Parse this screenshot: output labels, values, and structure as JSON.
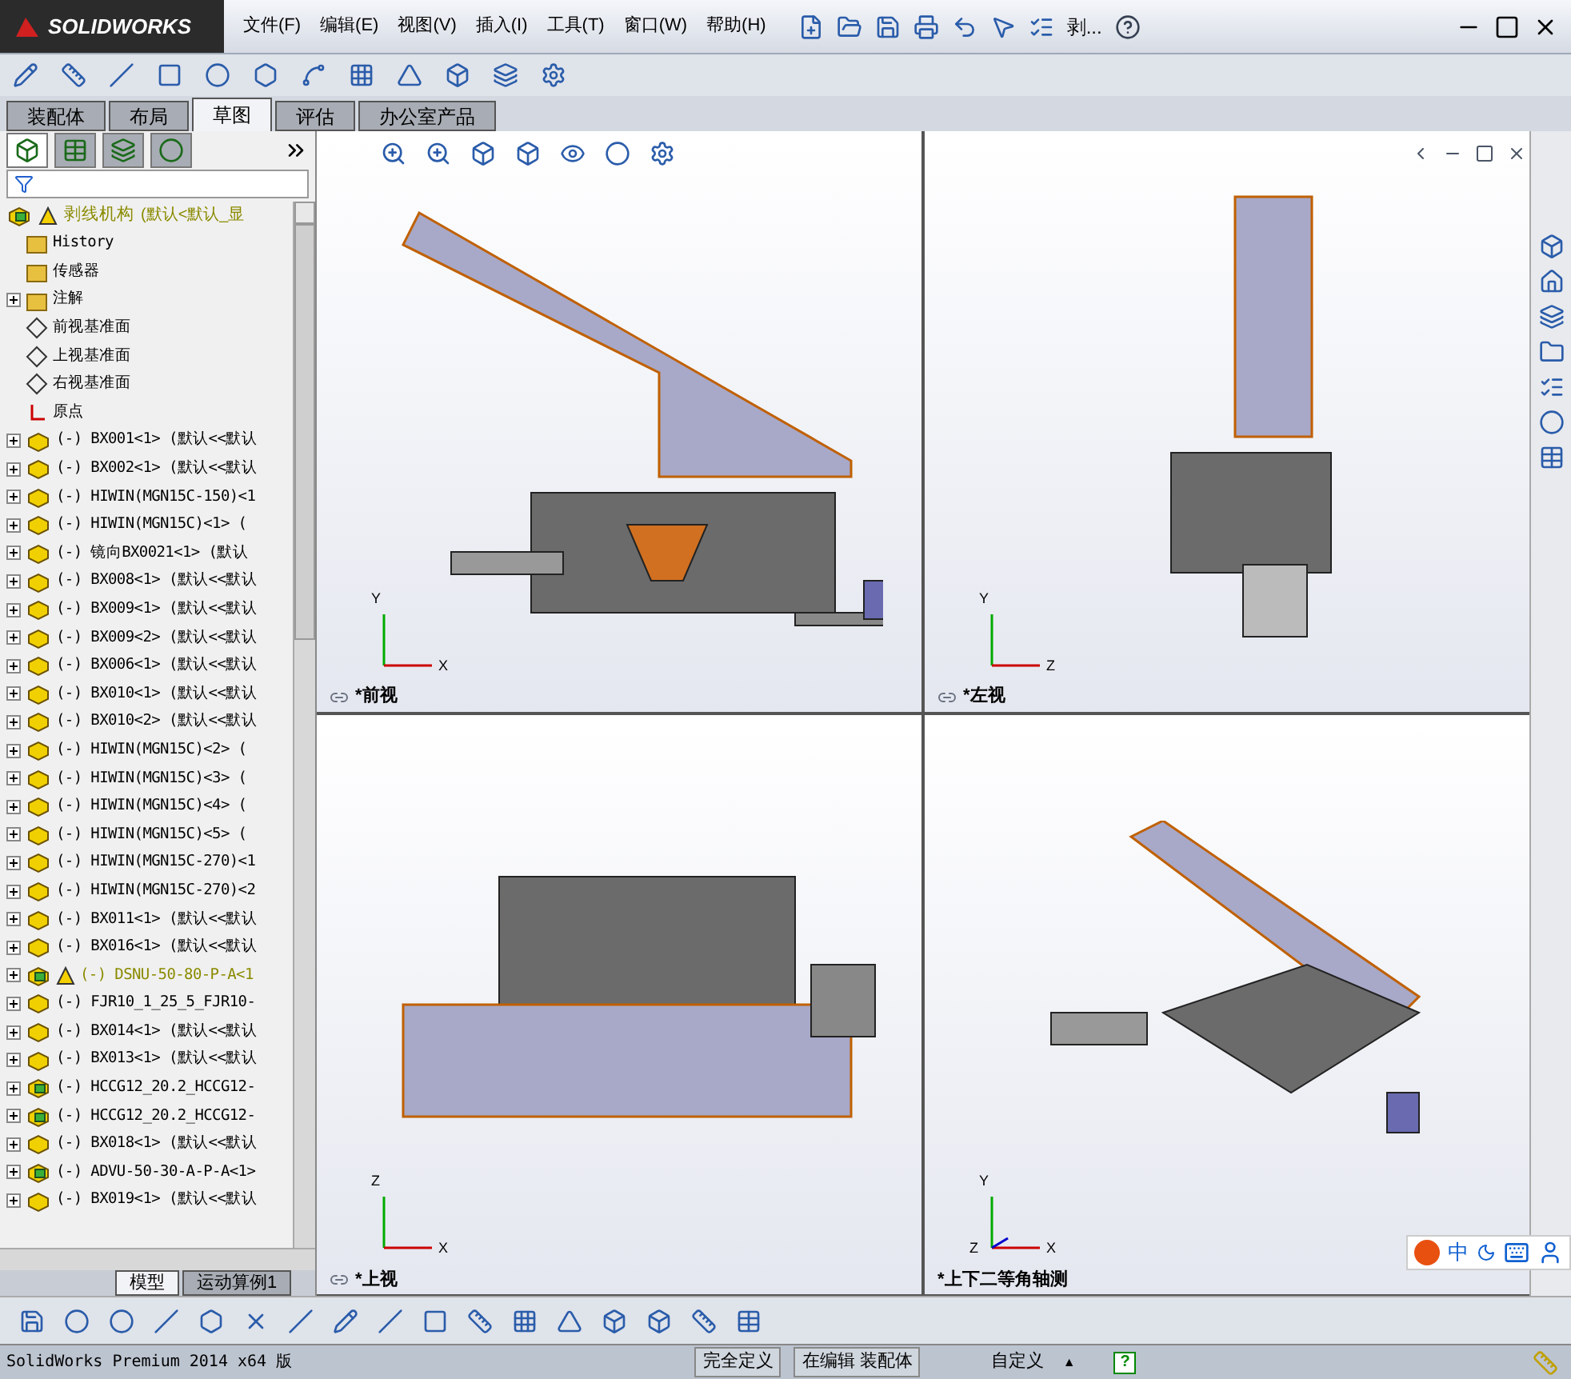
{
  "app": {
    "logo": "SOLIDWORKS",
    "menu": [
      "文件(F)",
      "编辑(E)",
      "视图(V)",
      "插入(I)",
      "工具(T)",
      "窗口(W)",
      "帮助(H)"
    ],
    "doc_title": "剥..."
  },
  "command_tabs": [
    {
      "label": "装配体",
      "selected": false
    },
    {
      "label": "布局",
      "selected": false
    },
    {
      "label": "草图",
      "selected": true
    },
    {
      "label": "评估",
      "selected": false
    },
    {
      "label": "办公室产品",
      "selected": false
    }
  ],
  "tree": {
    "root": {
      "label": "剥线机构",
      "config": "(默认<默认_显",
      "warning": true
    },
    "items": [
      {
        "kind": "history",
        "label": "History",
        "expandable": false
      },
      {
        "kind": "sensor",
        "label": "传感器",
        "expandable": false
      },
      {
        "kind": "annotation",
        "label": "注解",
        "expandable": true
      },
      {
        "kind": "plane",
        "label": "前视基准面",
        "expandable": false
      },
      {
        "kind": "plane",
        "label": "上视基准面",
        "expandable": false
      },
      {
        "kind": "plane",
        "label": "右视基准面",
        "expandable": false
      },
      {
        "kind": "origin",
        "label": "原点",
        "expandable": false
      },
      {
        "kind": "part",
        "label": "(-) BX001<1> (默认<<默认",
        "expandable": true,
        "warning": false
      },
      {
        "kind": "part",
        "label": "(-) BX002<1> (默认<<默认",
        "expandable": true,
        "warning": false
      },
      {
        "kind": "part",
        "label": "(-) HIWIN(MGN15C-150)<1",
        "expandable": true,
        "warning": false
      },
      {
        "kind": "part",
        "label": "(-) HIWIN(MGN15C)<1> (",
        "expandable": true,
        "warning": false
      },
      {
        "kind": "part",
        "label": "(-) 镜向BX0021<1> (默认",
        "expandable": true,
        "warning": false
      },
      {
        "kind": "part",
        "label": "(-) BX008<1> (默认<<默认",
        "expandable": true,
        "warning": false
      },
      {
        "kind": "part",
        "label": "(-) BX009<1> (默认<<默认",
        "expandable": true,
        "warning": false
      },
      {
        "kind": "part",
        "label": "(-) BX009<2> (默认<<默认",
        "expandable": true,
        "warning": false
      },
      {
        "kind": "part",
        "label": "(-) BX006<1> (默认<<默认",
        "expandable": true,
        "warning": false
      },
      {
        "kind": "part",
        "label": "(-) BX010<1> (默认<<默认",
        "expandable": true,
        "warning": false
      },
      {
        "kind": "part",
        "label": "(-) BX010<2> (默认<<默认",
        "expandable": true,
        "warning": false
      },
      {
        "kind": "part",
        "label": "(-) HIWIN(MGN15C)<2> (",
        "expandable": true,
        "warning": false
      },
      {
        "kind": "part",
        "label": "(-) HIWIN(MGN15C)<3> (",
        "expandable": true,
        "warning": false
      },
      {
        "kind": "part",
        "label": "(-) HIWIN(MGN15C)<4> (",
        "expandable": true,
        "warning": false
      },
      {
        "kind": "part",
        "label": "(-) HIWIN(MGN15C)<5> (",
        "expandable": true,
        "warning": false
      },
      {
        "kind": "part",
        "label": "(-) HIWIN(MGN15C-270)<1",
        "expandable": true,
        "warning": false
      },
      {
        "kind": "part",
        "label": "(-) HIWIN(MGN15C-270)<2",
        "expandable": true,
        "warning": false
      },
      {
        "kind": "part",
        "label": "(-) BX011<1> (默认<<默认",
        "expandable": true,
        "warning": false
      },
      {
        "kind": "part",
        "label": "(-) BX016<1> (默认<<默认",
        "expandable": true,
        "warning": false
      },
      {
        "kind": "assembly",
        "label": "(-) DSNU-50-80-P-A<1",
        "expandable": true,
        "warning": true
      },
      {
        "kind": "part",
        "label": "(-) FJR10_1_25_5_FJR10-",
        "expandable": true,
        "warning": false
      },
      {
        "kind": "part",
        "label": "(-) BX014<1> (默认<<默认",
        "expandable": true,
        "warning": false
      },
      {
        "kind": "part",
        "label": "(-) BX013<1> (默认<<默认",
        "expandable": true,
        "warning": false
      },
      {
        "kind": "assembly",
        "label": "(-) HCCG12_20.2_HCCG12-",
        "expandable": true,
        "warning": false
      },
      {
        "kind": "assembly",
        "label": "(-) HCCG12_20.2_HCCG12-",
        "expandable": true,
        "warning": false
      },
      {
        "kind": "part",
        "label": "(-) BX018<1> (默认<<默认",
        "expandable": true,
        "warning": false
      },
      {
        "kind": "assembly",
        "label": "(-) ADVU-50-30-A-P-A<1>",
        "expandable": true,
        "warning": false
      },
      {
        "kind": "part",
        "label": "(-) BX019<1> (默认<<默认",
        "expandable": true,
        "warning": false
      }
    ]
  },
  "bottom_tabs": [
    {
      "label": "模型",
      "selected": true
    },
    {
      "label": "运动算例1",
      "selected": false
    }
  ],
  "viewports": [
    {
      "kind": "front",
      "label": "*前视",
      "axes": [
        "Y",
        "X"
      ]
    },
    {
      "kind": "left",
      "label": "*左视",
      "axes": [
        "Y",
        "Z"
      ]
    },
    {
      "kind": "top",
      "label": "*上视",
      "axes": [
        "Z",
        "X"
      ]
    },
    {
      "kind": "iso",
      "label": "*上下二等角轴测",
      "axes": [
        "Y",
        "Z",
        "X"
      ]
    }
  ],
  "ime_bar": {
    "label": "中"
  },
  "status_bar": {
    "product": "SolidWorks Premium 2014 x64 版",
    "state": "完全定义",
    "mode": "在编辑 装配体",
    "units": "自定义",
    "caret": "▲",
    "help": "?"
  }
}
